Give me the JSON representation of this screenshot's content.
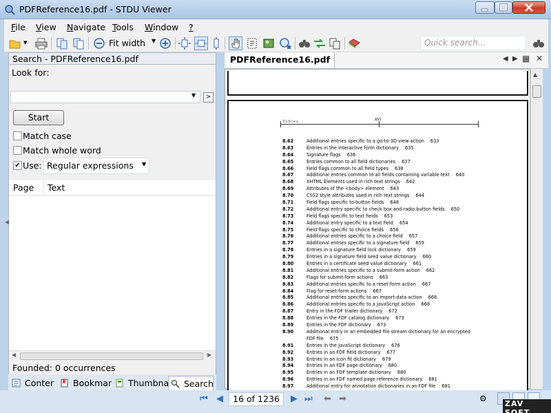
{
  "window": {
    "title": "PDFReference16.pdf - STDU Viewer"
  },
  "menu": [
    {
      "label": "File",
      "u": "F",
      "rest": "ile"
    },
    {
      "label": "View",
      "u": "V",
      "rest": "iew"
    },
    {
      "label": "Navigate",
      "u": "N",
      "rest": "avigate"
    },
    {
      "label": "Tools",
      "u": "T",
      "rest": "ools"
    },
    {
      "label": "Window",
      "u": "W",
      "rest": "indow"
    },
    {
      "label": "?",
      "u": "?",
      "rest": ""
    }
  ],
  "toolbar": {
    "zoom_mode": "Fit width",
    "quick_search_placeholder": "Quick search..."
  },
  "search_panel": {
    "header": "Search - PDFReference16.pdf",
    "look_for_label": "Look for:",
    "query_value": "",
    "start_label": "Start",
    "match_case_label": "Match case",
    "match_case_checked": false,
    "match_whole_word_label": "Match whole word",
    "match_whole_word_checked": false,
    "use_label": "Use:",
    "use_checked": true,
    "use_mode": "Regular expressions",
    "columns": {
      "page": "Page",
      "text": "Text"
    },
    "status": "Founded: 0 occurrences"
  },
  "left_tabs": [
    {
      "label": "Conter",
      "icon": "contents-icon"
    },
    {
      "label": "Bookmar",
      "icon": "bookmark-icon"
    },
    {
      "label": "Thumbna",
      "icon": "thumbnail-icon"
    },
    {
      "label": "Search",
      "icon": "search-icon",
      "active": true
    }
  ],
  "document": {
    "tab_label": "PDFReference16.pdf",
    "page_header_label": "Tables",
    "page_number": "xvi",
    "toc": [
      {
        "num": "8.62",
        "text": "Additional entries specific to a go-to-3D-view action",
        "page": "633"
      },
      {
        "num": "8.63",
        "text": "Entries in the interactive form dictionary",
        "page": "635"
      },
      {
        "num": "8.64",
        "text": "Signature flags",
        "page": "636"
      },
      {
        "num": "8.65",
        "text": "Entries common to all field dictionaries",
        "page": "637"
      },
      {
        "num": "8.66",
        "text": "Field flags common to all field types",
        "page": "638"
      },
      {
        "num": "8.67",
        "text": "Additional entries common to all fields containing variable text",
        "page": "640"
      },
      {
        "num": "8.68",
        "text": "XHTML Elements used in rich text strings",
        "page": "642"
      },
      {
        "num": "8.69",
        "text": "Attributes of the <body> element",
        "page": "643"
      },
      {
        "num": "8.70",
        "text": "CSS2 style attributes used in rich text strings",
        "page": "644"
      },
      {
        "num": "8.71",
        "text": "Field flags specific to button fields",
        "page": "648"
      },
      {
        "num": "8.72",
        "text": "Additional entry specific to check box and radio button fields",
        "page": "650"
      },
      {
        "num": "8.73",
        "text": "Field flags specific to text fields",
        "page": "653"
      },
      {
        "num": "8.74",
        "text": "Additional entry specific to a text field",
        "page": "654"
      },
      {
        "num": "8.75",
        "text": "Field flags specific to choice fields",
        "page": "656"
      },
      {
        "num": "8.76",
        "text": "Additional entries specific to a choice field",
        "page": "657"
      },
      {
        "num": "8.77",
        "text": "Additional entries specific to a signature field",
        "page": "659"
      },
      {
        "num": "8.78",
        "text": "Entries in a signature field lock dictionary",
        "page": "659"
      },
      {
        "num": "8.79",
        "text": "Entries in a signature field seed value dictionary",
        "page": "660"
      },
      {
        "num": "8.80",
        "text": "Entries in a certificate seed value dictionary",
        "page": "661"
      },
      {
        "num": "8.81",
        "text": "Additional entries specific to a submit-form action",
        "page": "662"
      },
      {
        "num": "8.82",
        "text": "Flags for submit-form actions",
        "page": "663"
      },
      {
        "num": "8.83",
        "text": "Additional entries specific to a reset-form action",
        "page": "667"
      },
      {
        "num": "8.84",
        "text": "Flag for reset-form actions",
        "page": "667"
      },
      {
        "num": "8.85",
        "text": "Additional entries specific to an import-data action",
        "page": "668"
      },
      {
        "num": "8.86",
        "text": "Additional entries specific to a JavaScript action",
        "page": "668"
      },
      {
        "num": "8.87",
        "text": "Entry in the FDF trailer dictionary",
        "page": "672"
      },
      {
        "num": "8.88",
        "text": "Entries in the FDF catalog dictionary",
        "page": "673"
      },
      {
        "num": "8.89",
        "text": "Entries in the FDF dictionary",
        "page": "673"
      },
      {
        "num": "8.90",
        "text": "Additional entry in an embedded file stream dictionary for an encrypted",
        "page": ""
      },
      {
        "num": "",
        "text": "FDF file",
        "page": "675"
      },
      {
        "num": "8.91",
        "text": "Entries in the JavaScript dictionary",
        "page": "676"
      },
      {
        "num": "8.92",
        "text": "Entries in an FDF field dictionary",
        "page": "677"
      },
      {
        "num": "8.93",
        "text": "Entries in an icon fit dictionary",
        "page": "679"
      },
      {
        "num": "8.94",
        "text": "Entries in an FDF page dictionary",
        "page": "680"
      },
      {
        "num": "8.95",
        "text": "Entries in an FDF template dictionary",
        "page": "680"
      },
      {
        "num": "8.96",
        "text": "Entries in an FDF named page reference dictionary",
        "page": "681"
      },
      {
        "num": "8.97",
        "text": "Additional entry for annotation dictionaries in an FDF file",
        "page": "681"
      }
    ]
  },
  "statusbar": {
    "page_indicator": "16 of 1236",
    "watermark": "ZAV SOFT"
  },
  "colors": {
    "accent": "#2f70c0",
    "close_button": "#c4402a"
  }
}
